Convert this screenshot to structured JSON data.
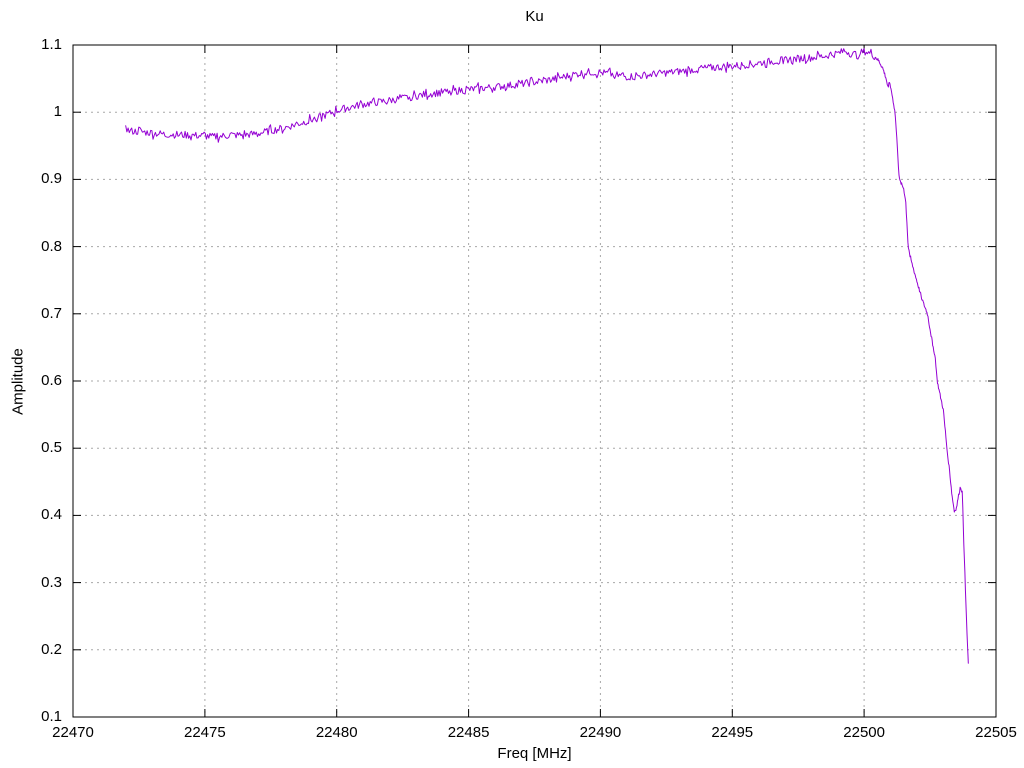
{
  "chart_data": {
    "type": "line",
    "title": "Ku",
    "xlabel": "Freq [MHz]",
    "ylabel": "Amplitude",
    "xlim": [
      22470,
      22505
    ],
    "ylim": [
      0.1,
      1.1
    ],
    "xticks": [
      22470,
      22475,
      22480,
      22485,
      22490,
      22495,
      22500,
      22505
    ],
    "xtick_labels": [
      "22470",
      "22475",
      "22480",
      "22485",
      "22490",
      "22495",
      "22500",
      "22505"
    ],
    "yticks": [
      0.1,
      0.2,
      0.3,
      0.4,
      0.5,
      0.6,
      0.7,
      0.8,
      0.9,
      1,
      1.1
    ],
    "ytick_labels": [
      "0.1",
      "0.2",
      "0.3",
      "0.4",
      "0.5",
      "0.6",
      "0.7",
      "0.8",
      "0.9",
      "1",
      "1.1"
    ],
    "grid": true,
    "legend": "none",
    "colors": {
      "background": "#ffffff",
      "border": "#000000",
      "grid": "#a8a8a8",
      "text": "#000000",
      "line": "#9400d3"
    },
    "series": [
      {
        "name": "Ku",
        "color": "#9400d3",
        "anchors": [
          [
            22472.0,
            0.984
          ],
          [
            22472.1,
            0.972
          ],
          [
            22472.5,
            0.971
          ],
          [
            22473.0,
            0.969
          ],
          [
            22473.5,
            0.967
          ],
          [
            22474.0,
            0.9665
          ],
          [
            22474.5,
            0.9655
          ],
          [
            22475.0,
            0.9645
          ],
          [
            22475.3,
            0.963
          ],
          [
            22475.7,
            0.9645
          ],
          [
            22476.0,
            0.9655
          ],
          [
            22476.5,
            0.966
          ],
          [
            22477.0,
            0.968
          ],
          [
            22477.5,
            0.9722
          ],
          [
            22478.0,
            0.9765
          ],
          [
            22478.5,
            0.982
          ],
          [
            22479.0,
            0.988
          ],
          [
            22479.5,
            0.9945
          ],
          [
            22480.0,
            1.002
          ],
          [
            22480.5,
            1.0075
          ],
          [
            22481.0,
            1.0115
          ],
          [
            22481.5,
            1.0145
          ],
          [
            22482.0,
            1.0175
          ],
          [
            22482.5,
            1.0205
          ],
          [
            22483.0,
            1.024
          ],
          [
            22483.5,
            1.027
          ],
          [
            22484.0,
            1.0295
          ],
          [
            22484.5,
            1.0315
          ],
          [
            22485.0,
            1.0335
          ],
          [
            22485.5,
            1.0355
          ],
          [
            22486.0,
            1.0375
          ],
          [
            22486.5,
            1.0395
          ],
          [
            22487.0,
            1.042
          ],
          [
            22487.5,
            1.0445
          ],
          [
            22488.0,
            1.0475
          ],
          [
            22488.5,
            1.0515
          ],
          [
            22489.0,
            1.056
          ],
          [
            22489.5,
            1.0595
          ],
          [
            22490.0,
            1.059
          ],
          [
            22490.4,
            1.0565
          ],
          [
            22491.0,
            1.0525
          ],
          [
            22491.5,
            1.054
          ],
          [
            22492.0,
            1.0565
          ],
          [
            22492.5,
            1.0585
          ],
          [
            22493.0,
            1.0605
          ],
          [
            22493.5,
            1.063
          ],
          [
            22494.0,
            1.0655
          ],
          [
            22494.5,
            1.067
          ],
          [
            22495.0,
            1.0685
          ],
          [
            22495.5,
            1.0705
          ],
          [
            22496.0,
            1.073
          ],
          [
            22496.5,
            1.0755
          ],
          [
            22497.0,
            1.078
          ],
          [
            22497.5,
            1.0795
          ],
          [
            22498.0,
            1.081
          ],
          [
            22498.5,
            1.0835
          ],
          [
            22499.0,
            1.0875
          ],
          [
            22499.3,
            1.0915
          ],
          [
            22499.55,
            1.0855
          ],
          [
            22499.8,
            1.088
          ],
          [
            22500.05,
            1.0905
          ],
          [
            22500.2,
            1.0875
          ],
          [
            22500.4,
            1.083
          ],
          [
            22500.55,
            1.0765
          ],
          [
            22500.7,
            1.066
          ],
          [
            22500.82,
            1.052
          ],
          [
            22500.9,
            1.0375
          ],
          [
            22500.97,
            1.046
          ],
          [
            22501.05,
            1.028
          ],
          [
            22501.17,
            1.0
          ],
          [
            22501.25,
            0.955
          ],
          [
            22501.33,
            0.9
          ],
          [
            22501.42,
            0.8925
          ],
          [
            22501.5,
            0.8865
          ],
          [
            22501.58,
            0.8655
          ],
          [
            22501.67,
            0.8
          ],
          [
            22501.8,
            0.7765
          ],
          [
            22501.95,
            0.7555
          ],
          [
            22502.1,
            0.7345
          ],
          [
            22502.25,
            0.7155
          ],
          [
            22502.4,
            0.7
          ],
          [
            22502.55,
            0.6655
          ],
          [
            22502.7,
            0.6335
          ],
          [
            22502.77,
            0.6
          ],
          [
            22502.9,
            0.5755
          ],
          [
            22503.0,
            0.5575
          ],
          [
            22503.14,
            0.5
          ],
          [
            22503.25,
            0.4625
          ],
          [
            22503.33,
            0.43
          ],
          [
            22503.42,
            0.406
          ],
          [
            22503.5,
            0.411
          ],
          [
            22503.58,
            0.4295
          ],
          [
            22503.65,
            0.4425
          ],
          [
            22503.72,
            0.4345
          ],
          [
            22503.78,
            0.3595
          ],
          [
            22503.84,
            0.2895
          ],
          [
            22503.9,
            0.2245
          ],
          [
            22503.95,
            0.18
          ]
        ],
        "noise": {
          "seed": 77,
          "step": 0.045,
          "amplitude": 0.0055,
          "spike_factor": 1.7,
          "until": 22500.4,
          "tail_step": 0.02,
          "tail_amplitude": 0.0025
        }
      }
    ]
  }
}
